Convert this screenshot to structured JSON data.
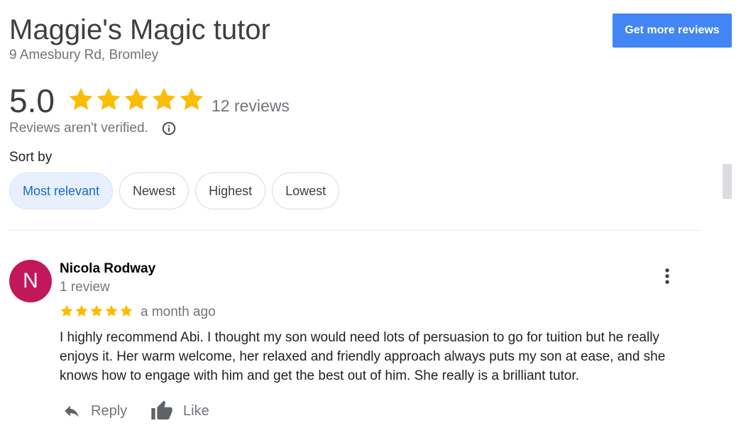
{
  "business": {
    "name": "Maggie's Magic tutor",
    "address": "9 Amesbury Rd, Bromley"
  },
  "header": {
    "cta_label": "Get more reviews"
  },
  "summary": {
    "rating": "5.0",
    "rating_value": 5,
    "rating_max": 5,
    "review_count": "12 reviews",
    "unverified_note": "Reviews aren't verified."
  },
  "sort": {
    "label": "Sort by",
    "options": [
      "Most relevant",
      "Newest",
      "Highest",
      "Lowest"
    ],
    "selected": "Most relevant"
  },
  "reviews": [
    {
      "avatar_letter": "N",
      "author": "Nicola Rodway",
      "author_meta": "1 review",
      "stars": 5,
      "time": "a month ago",
      "text": "I highly recommend Abi. I thought my son would need lots of persuasion to go for tuition but he really enjoys it. Her warm welcome, her relaxed and friendly approach always puts my son at ease, and she knows how to engage with him and get the best out of him. She really is a brilliant tutor.",
      "actions": {
        "reply_label": "Reply",
        "like_label": "Like"
      }
    }
  ],
  "icons": {
    "star": "star-icon",
    "info": "info-icon",
    "more": "more-vert-icon",
    "reply": "reply-arrow-icon",
    "like": "thumbs-up-icon"
  },
  "colors": {
    "star": "#fbbc04",
    "cta_bg": "#4285f4",
    "chip_active_bg": "#e8f0fe",
    "chip_active_text": "#1967d2",
    "avatar_bg": "#c2185b",
    "muted_text": "#70757a"
  }
}
